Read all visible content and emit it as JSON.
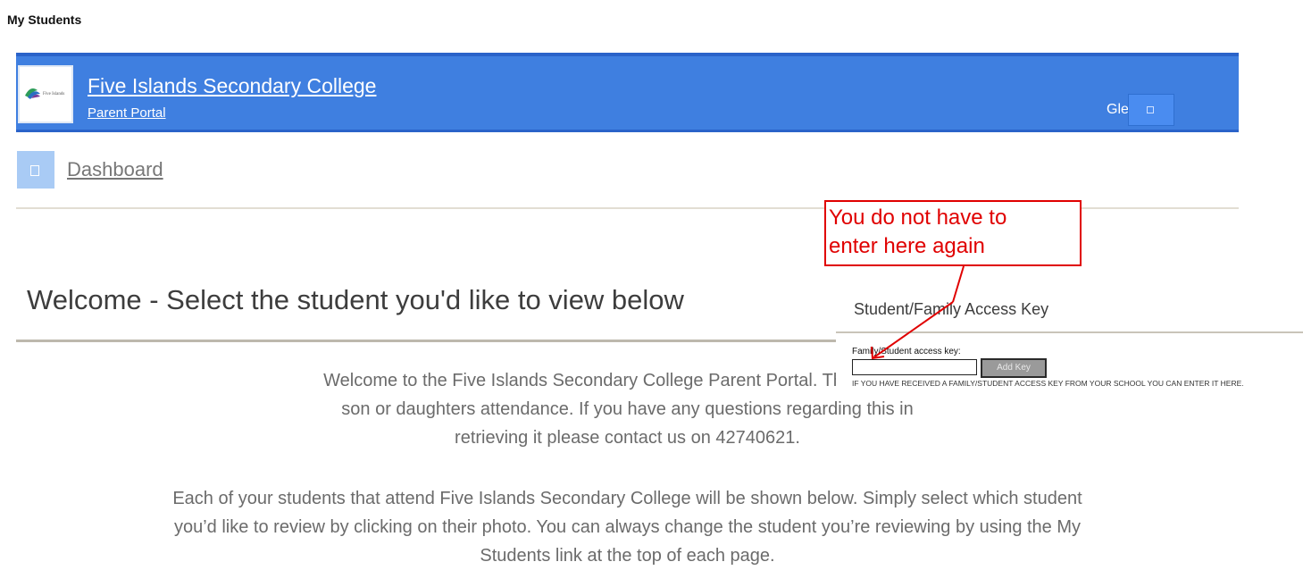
{
  "breadcrumb": "My Students",
  "header": {
    "school_name": "Five Islands Secondary College",
    "portal_label": "Parent Portal",
    "user_name": "Glenn Hite",
    "user_menu_icon": "square-icon",
    "logo_text": "Five Islands",
    "accent": "#3f7fe0"
  },
  "nav": {
    "dashboard_label": "Dashboard",
    "dashboard_icon": "square-icon"
  },
  "welcome": {
    "title": "Welcome - Select the student you'd like to view below",
    "line1": "Welcome to the Five Islands Secondary College Parent Portal. This will allow",
    "line2": "son or daughters attendance. If you have any questions regarding this in",
    "line3": "retrieving it please contact us on 42740621.",
    "info_line1": "Each of your students that attend Five Islands Secondary College will be shown below. Simply select which student",
    "info_line2": "you’d like to review by clicking on their photo. You can always change the student you’re reviewing by using the My",
    "info_line3": "Students link at the top of each page."
  },
  "access_key": {
    "title": "Student/Family Access Key",
    "field_label": "Family/Student access key:",
    "field_value": "",
    "button_label": "Add Key",
    "hint": "IF YOU HAVE RECEIVED A FAMILY/STUDENT ACCESS KEY FROM YOUR SCHOOL YOU CAN ENTER IT HERE."
  },
  "annotation": {
    "line1": "You do not have to",
    "line2": "enter here again",
    "color": "#e00000"
  }
}
